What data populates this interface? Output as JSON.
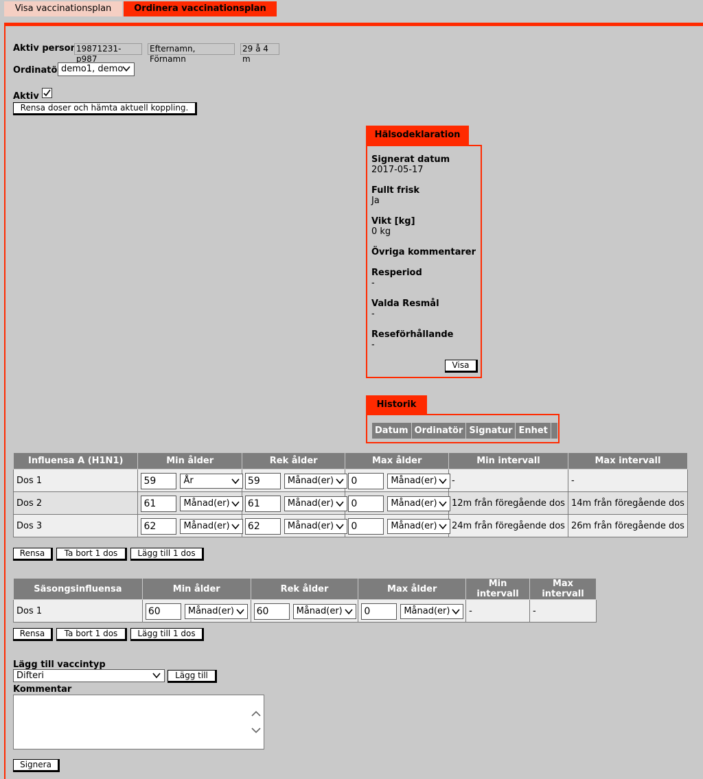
{
  "tabs": {
    "visa": "Visa vaccinationsplan",
    "ordinera": "Ordinera vaccinationsplan"
  },
  "person": {
    "label": "Aktiv person",
    "id": "19871231-p987",
    "name": "Efternamn, Förnamn",
    "age": "29 å 4 m"
  },
  "ordinator": {
    "label": "Ordinatör",
    "value": "demo1, demo"
  },
  "aktiv": {
    "label": "Aktiv",
    "checked": true
  },
  "reset_button": "Rensa doser och hämta aktuell koppling.",
  "halsodeklaration": {
    "title": "Hälsodeklaration",
    "items": [
      {
        "label": "Signerat datum",
        "value": "2017-05-17"
      },
      {
        "label": "Fullt frisk",
        "value": "Ja"
      },
      {
        "label": "Vikt [kg]",
        "value": "0 kg"
      },
      {
        "label": "Övriga kommentarer",
        "value": ""
      },
      {
        "label": "Resperiod",
        "value": "-"
      },
      {
        "label": "Valda Resmål",
        "value": "-"
      },
      {
        "label": "Reseförhållande",
        "value": "-"
      }
    ],
    "visa_button": "Visa"
  },
  "historik": {
    "title": "Historik",
    "columns": [
      "Datum",
      "Ordinatör",
      "Signatur",
      "Enhet"
    ]
  },
  "table1": {
    "columns": [
      "Influensa A (H1N1)",
      "Min ålder",
      "Rek ålder",
      "Max ålder",
      "Min intervall",
      "Max intervall"
    ],
    "rows": [
      {
        "dose": "Dos 1",
        "min": "59",
        "min_unit": "År",
        "rek": "59",
        "rek_unit": "Månad(er)",
        "max": "0",
        "max_unit": "Månad(er)",
        "min_int": "-",
        "max_int": "-"
      },
      {
        "dose": "Dos 2",
        "min": "61",
        "min_unit": "Månad(er)",
        "rek": "61",
        "rek_unit": "Månad(er)",
        "max": "0",
        "max_unit": "Månad(er)",
        "min_int": "12m från föregående dos",
        "max_int": "14m från föregående dos"
      },
      {
        "dose": "Dos 3",
        "min": "62",
        "min_unit": "Månad(er)",
        "rek": "62",
        "rek_unit": "Månad(er)",
        "max": "0",
        "max_unit": "Månad(er)",
        "min_int": "24m från föregående dos",
        "max_int": "26m från föregående dos"
      }
    ]
  },
  "table2": {
    "columns": [
      "Säsongsinfluensa",
      "Min ålder",
      "Rek ålder",
      "Max ålder",
      "Min intervall",
      "Max intervall"
    ],
    "rows": [
      {
        "dose": "Dos 1",
        "min": "60",
        "min_unit": "Månad(er)",
        "rek": "60",
        "rek_unit": "Månad(er)",
        "max": "0",
        "max_unit": "Månad(er)",
        "min_int": "-",
        "max_int": "-"
      }
    ]
  },
  "dose_buttons": {
    "rensa": "Rensa",
    "ta_bort": "Ta bort 1 dos",
    "lagg_till": "Lägg till 1 dos"
  },
  "add_vaccine": {
    "label": "Lägg till vaccintyp",
    "selected": "Difteri",
    "button": "Lägg till"
  },
  "comment": {
    "label": "Kommentar",
    "value": ""
  },
  "sign_button": "Signera",
  "colors": {
    "accent": "#ff2a00",
    "tab_light": "#f5cfc3",
    "header_gray": "#7d7d7d"
  }
}
